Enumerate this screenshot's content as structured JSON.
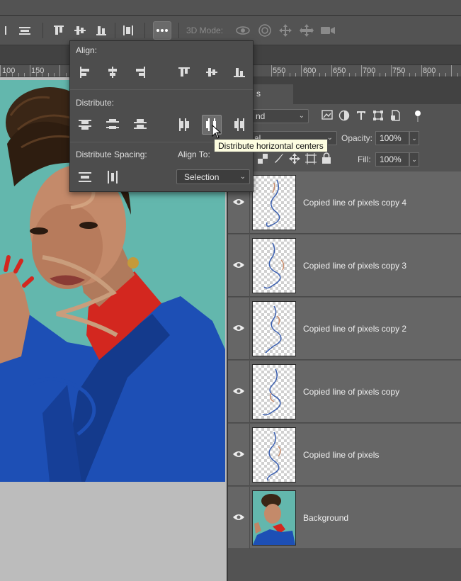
{
  "options_bar": {
    "mode_3d_label": "3D Mode:",
    "more_icon": "ellipsis-icon"
  },
  "ruler": {
    "labels": [
      "100",
      "150",
      "550",
      "600",
      "650",
      "700",
      "750",
      "800"
    ]
  },
  "align_popup": {
    "align_label": "Align:",
    "distribute_label": "Distribute:",
    "distribute_spacing_label": "Distribute Spacing:",
    "align_to_label": "Align To:",
    "align_to_value": "Selection"
  },
  "tooltip": {
    "text": "Distribute horizontal centers"
  },
  "layers_panel": {
    "tab_label": "s",
    "kind_value": "nd",
    "blend_value": "al",
    "opacity_label": "Opacity:",
    "opacity_value": "100%",
    "fill_label": "Fill:",
    "fill_value": "100%",
    "layers": [
      {
        "name": "Copied line of pixels copy 4",
        "visible": true
      },
      {
        "name": "Copied line of pixels copy 3",
        "visible": true
      },
      {
        "name": "Copied line of pixels copy 2",
        "visible": true
      },
      {
        "name": "Copied line of pixels copy",
        "visible": true
      },
      {
        "name": "Copied line of pixels",
        "visible": true
      },
      {
        "name": "Background",
        "visible": true
      }
    ]
  },
  "colors": {
    "canvas_bg": "#63b7ad",
    "jacket_blue": "#1d4fb5",
    "collar_red": "#d3271f",
    "tooltip_bg": "#fdfde0"
  }
}
